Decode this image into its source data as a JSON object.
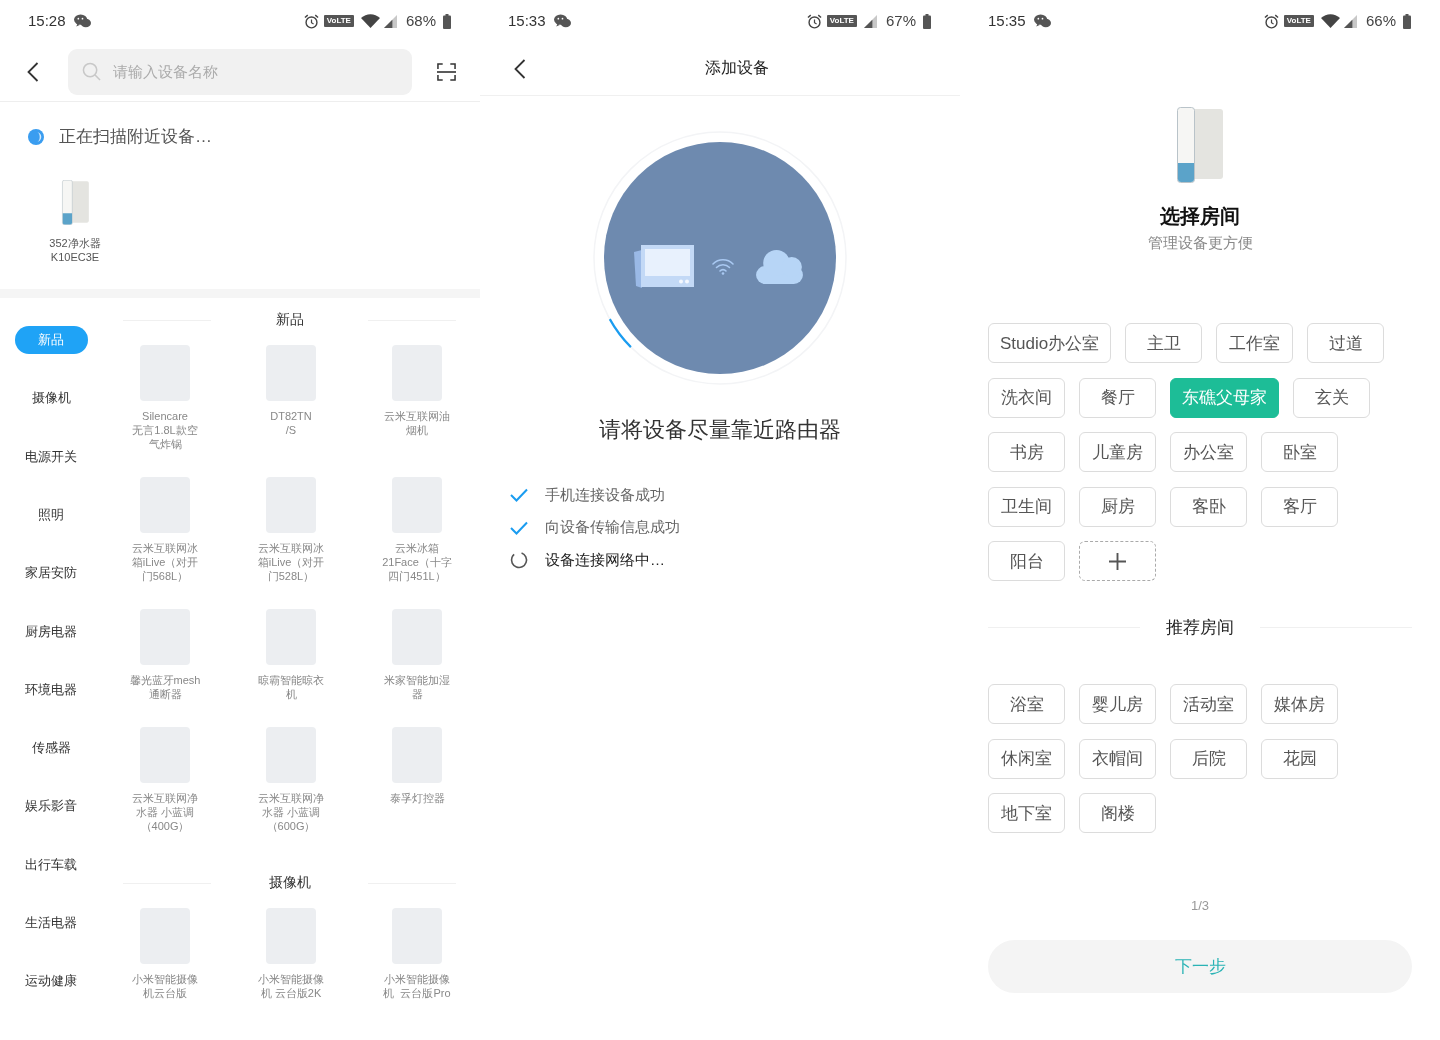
{
  "search_screen": {
    "status_bar": {
      "time": "15:28",
      "network": "VoLTE",
      "wifi_connected": true,
      "battery": "68%"
    },
    "search_field": {
      "placeholder": "请输入设备名称"
    },
    "scan_status": "正在扫描附近设备…",
    "nearby_devices": [
      {
        "name": "352净水器\nK10EC3E"
      }
    ],
    "categories": [
      {
        "label": "新品",
        "selected": true
      },
      {
        "label": "摄像机",
        "selected": false
      },
      {
        "label": "电源开关",
        "selected": false
      },
      {
        "label": "照明",
        "selected": false
      },
      {
        "label": "家居安防",
        "selected": false
      },
      {
        "label": "厨房电器",
        "selected": false
      },
      {
        "label": "环境电器",
        "selected": false
      },
      {
        "label": "传感器",
        "selected": false
      },
      {
        "label": "娱乐影音",
        "selected": false
      },
      {
        "label": "出行车载",
        "selected": false
      },
      {
        "label": "生活电器",
        "selected": false
      },
      {
        "label": "运动健康",
        "selected": false
      }
    ],
    "sections": [
      {
        "title": "新品",
        "products": [
          {
            "name": "Silencare\n无言1.8L款空气炸锅"
          },
          {
            "name": "DT82TN\n/S"
          },
          {
            "name": "云米互联网油烟机"
          },
          {
            "name": "云米互联网冰箱iLive（对开门568L）"
          },
          {
            "name": "云米互联网冰箱iLive（对开门528L）"
          },
          {
            "name": "云米冰箱21Face（十字四门451L）"
          },
          {
            "name": "馨光蓝牙mesh\n通断器"
          },
          {
            "name": "晾霸智能晾衣机"
          },
          {
            "name": "米家智能加湿器"
          },
          {
            "name": "云米互联网净水器 小蓝调（400G）"
          },
          {
            "name": "云米互联网净水器 小蓝调（600G）"
          },
          {
            "name": "泰孚灯控器"
          }
        ]
      },
      {
        "title": "摄像机",
        "products": [
          {
            "name": "小米智能摄像机云台版"
          },
          {
            "name": "小米智能摄像机 云台版2K"
          },
          {
            "name": "小米智能摄像机  云台版Pro"
          }
        ]
      }
    ]
  },
  "pairing_screen": {
    "status_bar": {
      "time": "15:33",
      "network": "VoLTE",
      "wifi_connected": false,
      "battery": "67%"
    },
    "title": "添加设备",
    "instruction": "请将设备尽量靠近路由器",
    "steps": [
      {
        "label": "手机连接设备成功",
        "done": true
      },
      {
        "label": "向设备传输信息成功",
        "done": true
      },
      {
        "label": "设备连接网络中…",
        "done": false
      }
    ]
  },
  "room_screen": {
    "status_bar": {
      "time": "15:35",
      "network": "VoLTE",
      "wifi_connected": true,
      "battery": "66%"
    },
    "title": "选择房间",
    "subtitle": "管理设备更方便",
    "rooms": [
      {
        "label": "Studio办公室",
        "selected": false
      },
      {
        "label": "主卫",
        "selected": false
      },
      {
        "label": "工作室",
        "selected": false
      },
      {
        "label": "过道",
        "selected": false
      },
      {
        "label": "洗衣间",
        "selected": false
      },
      {
        "label": "餐厅",
        "selected": false
      },
      {
        "label": "东礁父母家",
        "selected": true
      },
      {
        "label": "玄关",
        "selected": false
      },
      {
        "label": "书房",
        "selected": false
      },
      {
        "label": "儿童房",
        "selected": false
      },
      {
        "label": "办公室",
        "selected": false
      },
      {
        "label": "卧室",
        "selected": false
      },
      {
        "label": "卫生间",
        "selected": false
      },
      {
        "label": "厨房",
        "selected": false
      },
      {
        "label": "客卧",
        "selected": false
      },
      {
        "label": "客厅",
        "selected": false
      },
      {
        "label": "阳台",
        "selected": false
      }
    ],
    "recommended_title": "推荐房间",
    "recommended_rooms": [
      {
        "label": "浴室",
        "selected": false
      },
      {
        "label": "婴儿房",
        "selected": false
      },
      {
        "label": "活动室",
        "selected": false
      },
      {
        "label": "媒体房",
        "selected": false
      },
      {
        "label": "休闲室",
        "selected": false
      },
      {
        "label": "衣帽间",
        "selected": false
      },
      {
        "label": "后院",
        "selected": false
      },
      {
        "label": "花园",
        "selected": false
      },
      {
        "label": "地下室",
        "selected": false
      },
      {
        "label": "阁楼",
        "selected": false
      }
    ],
    "page_indicator": "1/3",
    "next_button": "下一步"
  }
}
